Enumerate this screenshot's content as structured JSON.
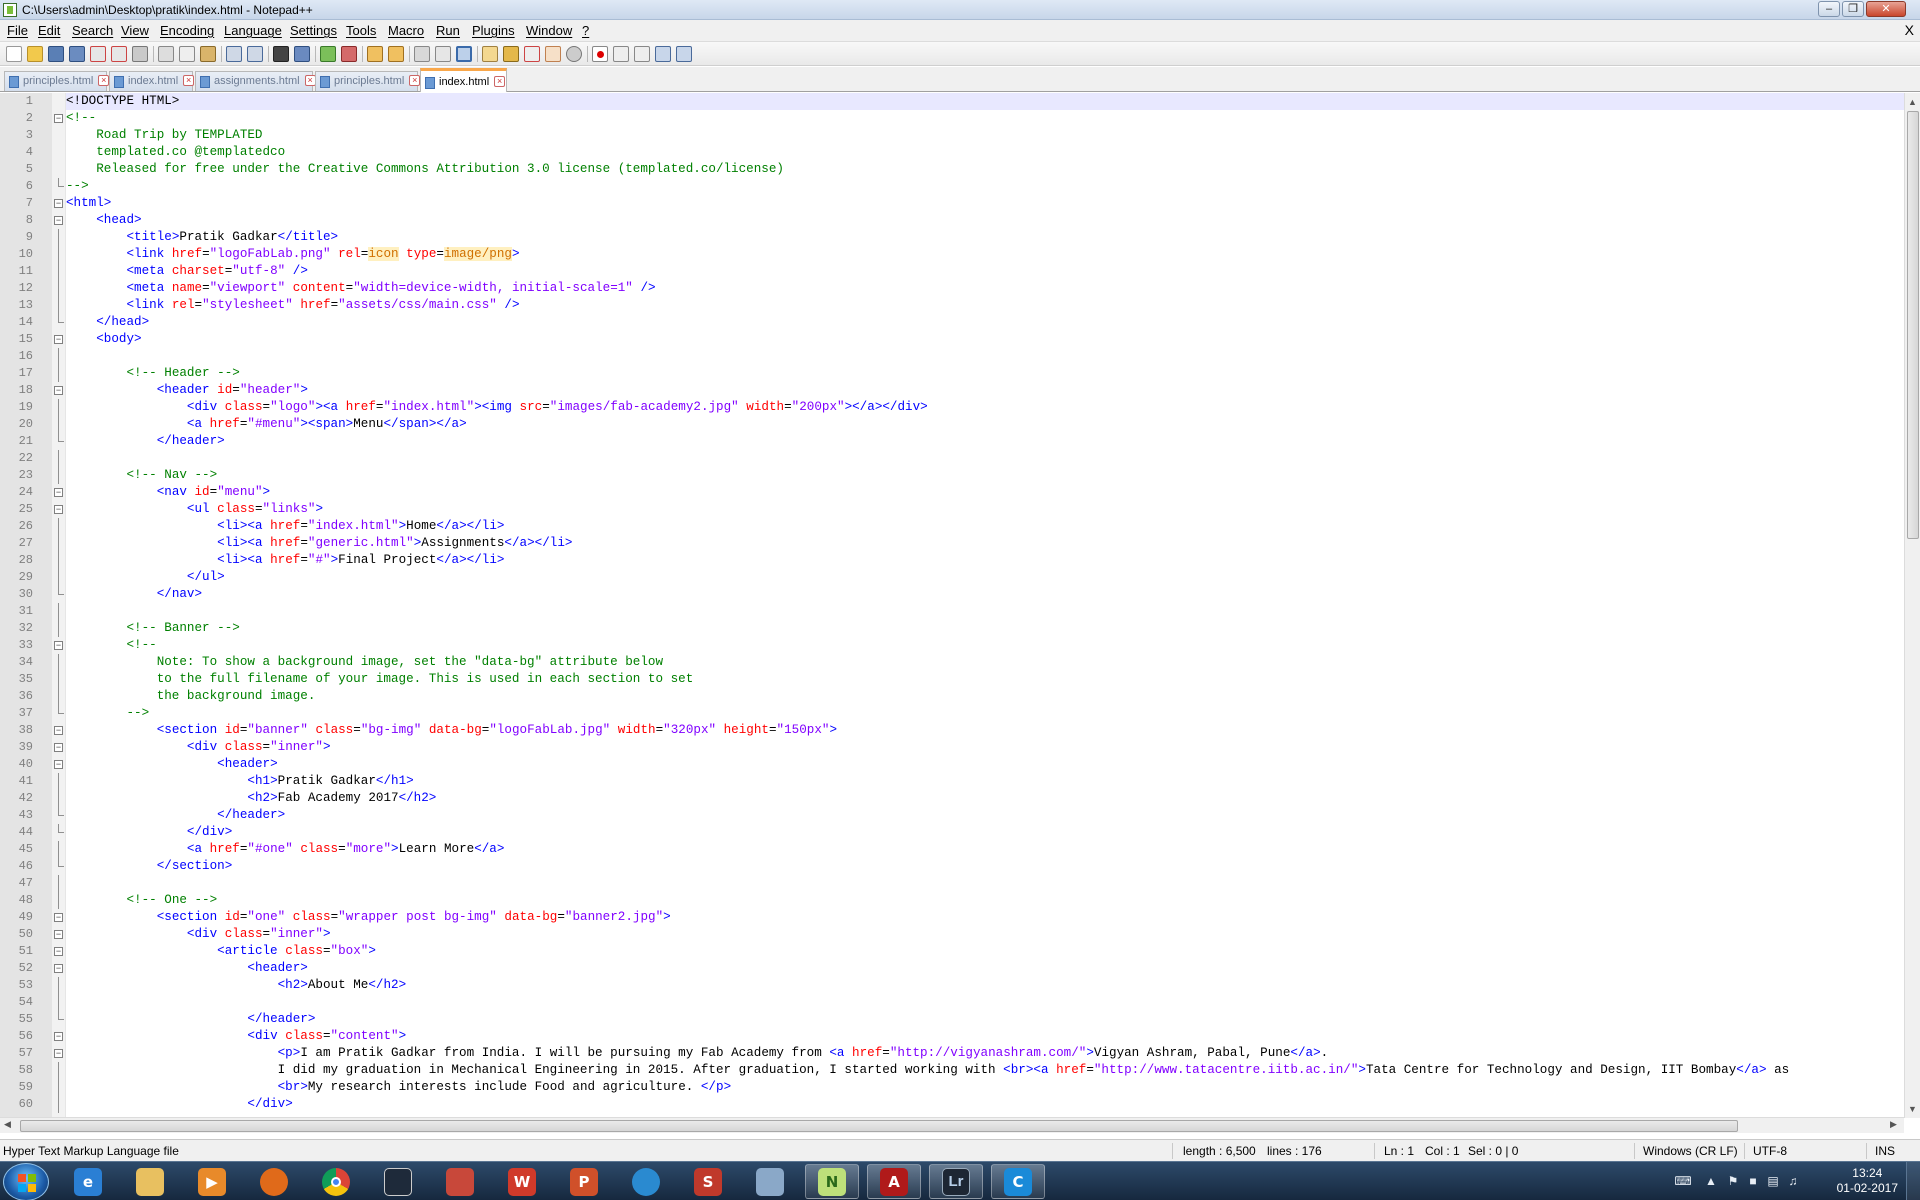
{
  "window": {
    "title": "C:\\Users\\admin\\Desktop\\pratik\\index.html - Notepad++"
  },
  "menu": [
    "File",
    "Edit",
    "Search",
    "View",
    "Encoding",
    "Language",
    "Settings",
    "Tools",
    "Macro",
    "Run",
    "Plugins",
    "Window",
    "?"
  ],
  "menu_close": "X",
  "toolbar_icons": [
    "new-file-icon",
    "open-file-icon",
    "save-icon",
    "save-all-icon",
    "close-icon",
    "close-all-icon",
    "print-icon",
    "cut-icon",
    "copy-icon",
    "paste-icon",
    "undo-icon",
    "redo-icon",
    "find-icon",
    "replace-icon",
    "zoom-in-icon",
    "zoom-out-icon",
    "sync-vertical-icon",
    "sync-horizontal-icon",
    "word-wrap-icon",
    "show-all-chars-icon",
    "indent-guide-icon",
    "user-language-icon",
    "document-map-icon",
    "function-list-icon",
    "folder-workspace-icon",
    "monitoring-icon",
    "record-macro-icon",
    "stop-macro-icon",
    "play-macro-icon",
    "run-macro-multiple-icon",
    "save-macro-icon"
  ],
  "tabs": [
    {
      "label": "principles.html",
      "active": false
    },
    {
      "label": "index.html",
      "active": false
    },
    {
      "label": "assignments.html",
      "active": false
    },
    {
      "label": "principles.html",
      "active": false
    },
    {
      "label": "index.html",
      "active": true
    }
  ],
  "code_lines": [
    "<!DOCTYPE HTML>",
    "<!--",
    "    Road Trip by TEMPLATED",
    "    templated.co @templatedco",
    "    Released for free under the Creative Commons Attribution 3.0 license (templated.co/license)",
    "-->",
    "<html>",
    "    <head>",
    "        <title>Pratik Gadkar</title>",
    "        <link href=\"logoFabLab.png\" rel=icon type=image/png>",
    "        <meta charset=\"utf-8\" />",
    "        <meta name=\"viewport\" content=\"width=device-width, initial-scale=1\" />",
    "        <link rel=\"stylesheet\" href=\"assets/css/main.css\" />",
    "    </head>",
    "    <body>",
    "",
    "        <!-- Header -->",
    "            <header id=\"header\">",
    "                <div class=\"logo\"><a href=\"index.html\"><img src=\"images/fab-academy2.jpg\" width=\"200px\"></a></div>",
    "                <a href=\"#menu\"><span>Menu</span></a>",
    "            </header>",
    "",
    "        <!-- Nav -->",
    "            <nav id=\"menu\">",
    "                <ul class=\"links\">",
    "                    <li><a href=\"index.html\">Home</a></li>",
    "                    <li><a href=\"generic.html\">Assignments</a></li>",
    "                    <li><a href=\"#\">Final Project</a></li>",
    "                </ul>",
    "            </nav>",
    "",
    "        <!-- Banner -->",
    "        <!--",
    "            Note: To show a background image, set the \"data-bg\" attribute below",
    "            to the full filename of your image. This is used in each section to set",
    "            the background image.",
    "        -->",
    "            <section id=\"banner\" class=\"bg-img\" data-bg=\"logoFabLab.jpg\" width=\"320px\" height=\"150px\">",
    "                <div class=\"inner\">",
    "                    <header>",
    "                        <h1>Pratik Gadkar</h1>",
    "                        <h2>Fab Academy 2017</h2>",
    "                    </header>",
    "                </div>",
    "                <a href=\"#one\" class=\"more\">Learn More</a>",
    "            </section>",
    "",
    "        <!-- One -->",
    "            <section id=\"one\" class=\"wrapper post bg-img\" data-bg=\"banner2.jpg\">",
    "                <div class=\"inner\">",
    "                    <article class=\"box\">",
    "                        <header>",
    "                            <h2>About Me</h2>",
    "",
    "                        </header>",
    "                        <div class=\"content\">",
    "                            <p>I am Pratik Gadkar from India. I will be pursuing my Fab Academy from <a href=\"http://vigyanashram.com/\">Vigyan Ashram, Pabal, Pune</a>.",
    "                            I did my graduation in Mechanical Engineering in 2015. After graduation, I started working with <br><a href=\"http://www.tatacentre.iitb.ac.in/\">Tata Centre for Technology and Design, IIT Bombay</a> as",
    "                            <br>My research interests include Food and agriculture. </p>",
    "                        </div>"
  ],
  "status": {
    "file_type": "Hyper Text Markup Language file",
    "length": "length : 6,500",
    "lines": "lines : 176",
    "ln": "Ln : 1",
    "col": "Col : 1",
    "sel": "Sel : 0 | 0",
    "eol": "Windows (CR LF)",
    "encoding": "UTF-8",
    "mode": "INS"
  },
  "taskbar": {
    "apps": [
      "internet-explorer",
      "file-explorer",
      "media-player",
      "firefox",
      "chrome",
      "app-icon",
      "app-icon",
      "wps-writer",
      "wps-presentation",
      "app-icon",
      "wps-spreadsheets",
      "network-app",
      "notepad-plus-plus",
      "acrobat-reader",
      "lightroom",
      "ccleaner"
    ],
    "clock_time": "13:24",
    "clock_date": "01-02-2017"
  },
  "colors": {
    "tag": "#0000ff",
    "attr": "#ff0000",
    "value": "#8000ff",
    "comment": "#008000",
    "undefined_attr": "#d07000",
    "active_tab_accent": "#f9a74a",
    "current_line": "#e8e8ff"
  }
}
